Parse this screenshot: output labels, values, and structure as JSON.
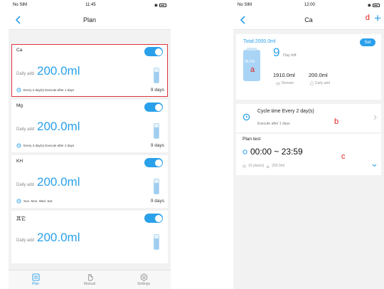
{
  "left_screen": {
    "status": {
      "carrier": "No SIM",
      "time": "11:45"
    },
    "nav": {
      "title": "Plan"
    },
    "plans": [
      {
        "name": "Ca",
        "enabled": true,
        "daily_label": "Daily add",
        "daily_value": "200.0ml",
        "cycle": "Every 2 day(s)  Execute after 1 days",
        "days": "9 days",
        "highlighted": true
      },
      {
        "name": "Mg",
        "enabled": true,
        "daily_label": "Daily add",
        "daily_value": "200.0ml",
        "cycle": "Every 3 day(s)  Execute after 2 days",
        "days": "9 days"
      },
      {
        "name": "KH",
        "enabled": true,
        "daily_label": "Daily add",
        "daily_value": "200.0ml",
        "cycle": "Sun. Mon. Wed. Sat.",
        "days": "9 days"
      },
      {
        "name": "其它",
        "enabled": true,
        "daily_label": "Daily add",
        "daily_value": "200.0ml",
        "cycle": "",
        "days": ""
      }
    ],
    "tabs": [
      {
        "label": "Plan",
        "icon": "plan-icon",
        "active": true
      },
      {
        "label": "Manual",
        "icon": "hand-icon",
        "active": false
      },
      {
        "label": "Settings",
        "icon": "gear-icon",
        "active": false
      }
    ]
  },
  "right_screen": {
    "status": {
      "carrier": "No SIM",
      "time": "12:00"
    },
    "nav": {
      "title": "Ca",
      "add_label": "+"
    },
    "summary": {
      "total": "Total:2000.0ml",
      "set_label": "Set",
      "percent": "95.5%",
      "days_left_number": "9",
      "days_left_label": "Day left",
      "remain_value": "1910.0ml",
      "remain_label": "Remain",
      "daily_value": "200.0ml",
      "daily_label": "Daily add"
    },
    "cycle": {
      "title": "Cycle time   Every 2 day(s)",
      "subtitle": "Execute after 1 days"
    },
    "plan_test": {
      "title": "Plan test",
      "time_range": "00:00 ~ 23:59",
      "plans_count": "10 plan(s)",
      "amount": "200.0ml"
    },
    "annotations": {
      "a": "a",
      "b": "b",
      "c": "c",
      "d": "d"
    }
  },
  "colors": {
    "accent": "#2aa0ea",
    "highlight": "#e0343a",
    "annotation": "#e02020"
  }
}
